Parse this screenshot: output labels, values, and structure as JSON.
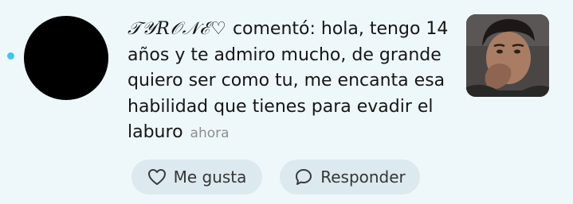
{
  "notification": {
    "username": "𝒯𝒴𝑅𝒪𝒩ℰ♡",
    "action": "comentó:",
    "comment": "hola, tengo 14 años y te admiro mucho, de grande quiero ser como tu, me encanta esa habilidad que tienes para evadir el laburo",
    "timestamp": "ahora",
    "unread": true
  },
  "actions": {
    "like_label": "Me gusta",
    "reply_label": "Responder"
  },
  "icons": {
    "like": "heart-outline-icon",
    "reply": "speech-bubble-icon"
  },
  "colors": {
    "background": "#eef8fb",
    "unread_dot": "#3ec6e8",
    "button_bg": "#dce9ee",
    "timestamp": "#8d8d8d"
  }
}
